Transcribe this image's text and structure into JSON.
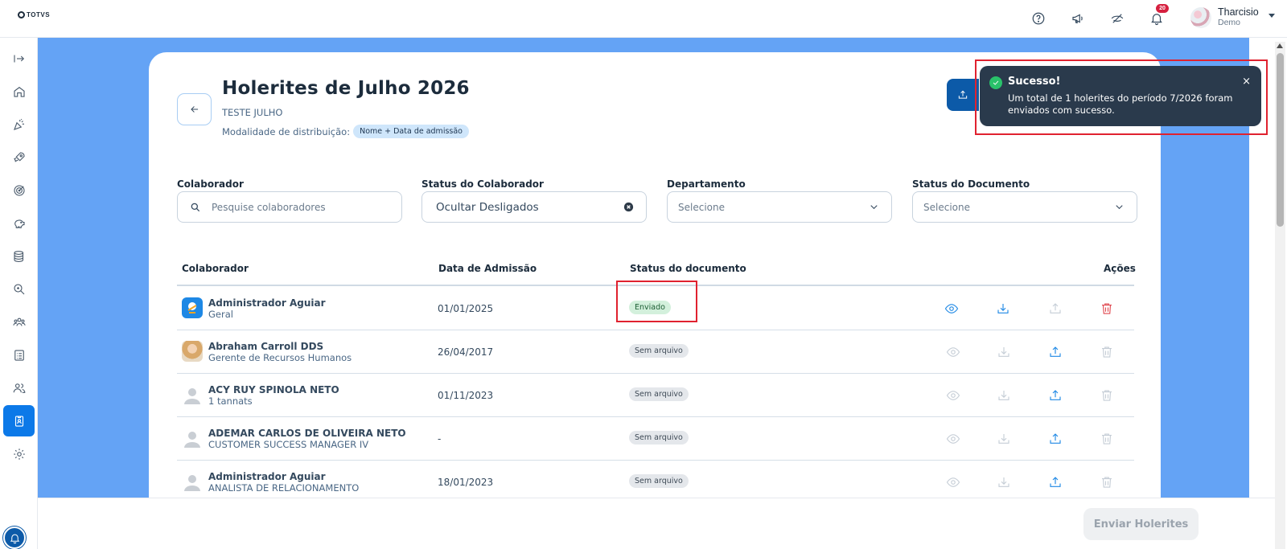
{
  "topbar": {
    "logo_text": "TOTVS",
    "notification_count": "20",
    "user_name": "Tharcisio",
    "user_role": "Demo"
  },
  "sidebar": {
    "icons": [
      "expand-icon",
      "home-icon",
      "party-icon",
      "rocket-icon",
      "target-icon",
      "piggy-bank-icon",
      "database-icon",
      "search-zoom-icon",
      "team-icon",
      "checklist-icon",
      "people-icon",
      "badge-icon",
      "gear-icon"
    ],
    "active_index": 11
  },
  "header": {
    "title": "Holerites de Julho 2026",
    "subtitle": "TESTE JULHO",
    "modality_label": "Modalidade de distribuição:",
    "modality_value": "Nome + Data de admissão"
  },
  "filters": {
    "collaborator": {
      "label": "Colaborador",
      "placeholder": "Pesquise colaboradores"
    },
    "collaborator_status": {
      "label": "Status do Colaborador",
      "value": "Ocultar Desligados"
    },
    "department": {
      "label": "Departamento",
      "value": "Selecione"
    },
    "document_status": {
      "label": "Status do Documento",
      "value": "Selecione"
    }
  },
  "table": {
    "headers": {
      "collaborator": "Colaborador",
      "admission": "Data de Admissão",
      "doc_status": "Status do documento",
      "actions": "Ações"
    },
    "rows": [
      {
        "name": "Administrador Aguiar",
        "role": "Geral",
        "date": "01/01/2025",
        "status": "Enviado",
        "avatar": "logo"
      },
      {
        "name": "Abraham Carroll DDS",
        "role": "Gerente de Recursos Humanos",
        "date": "26/04/2017",
        "status": "Sem arquivo",
        "avatar": "photo"
      },
      {
        "name": "ACY RUY SPINOLA NETO",
        "role": "1 tannats",
        "date": "01/11/2023",
        "status": "Sem arquivo",
        "avatar": "placeholder"
      },
      {
        "name": "ADEMAR CARLOS DE OLIVEIRA NETO",
        "role": "CUSTOMER SUCCESS MANAGER IV",
        "date": "-",
        "status": "Sem arquivo",
        "avatar": "placeholder"
      },
      {
        "name": "Administrador Aguiar",
        "role": "ANALISTA DE RELACIONAMENTO",
        "date": "18/01/2023",
        "status": "Sem arquivo",
        "avatar": "placeholder"
      }
    ]
  },
  "toast": {
    "title": "Sucesso!",
    "message": "Um total de 1 holerites do período 7/2026 foram enviados com sucesso.",
    "close": "×"
  },
  "footer": {
    "send_label": "Enviar Holerites"
  },
  "colors": {
    "primary": "#0c79e8",
    "dark_primary": "#0c5aa8",
    "background": "#64a3f5",
    "success": "#29c26a",
    "danger": "#e0222f"
  }
}
